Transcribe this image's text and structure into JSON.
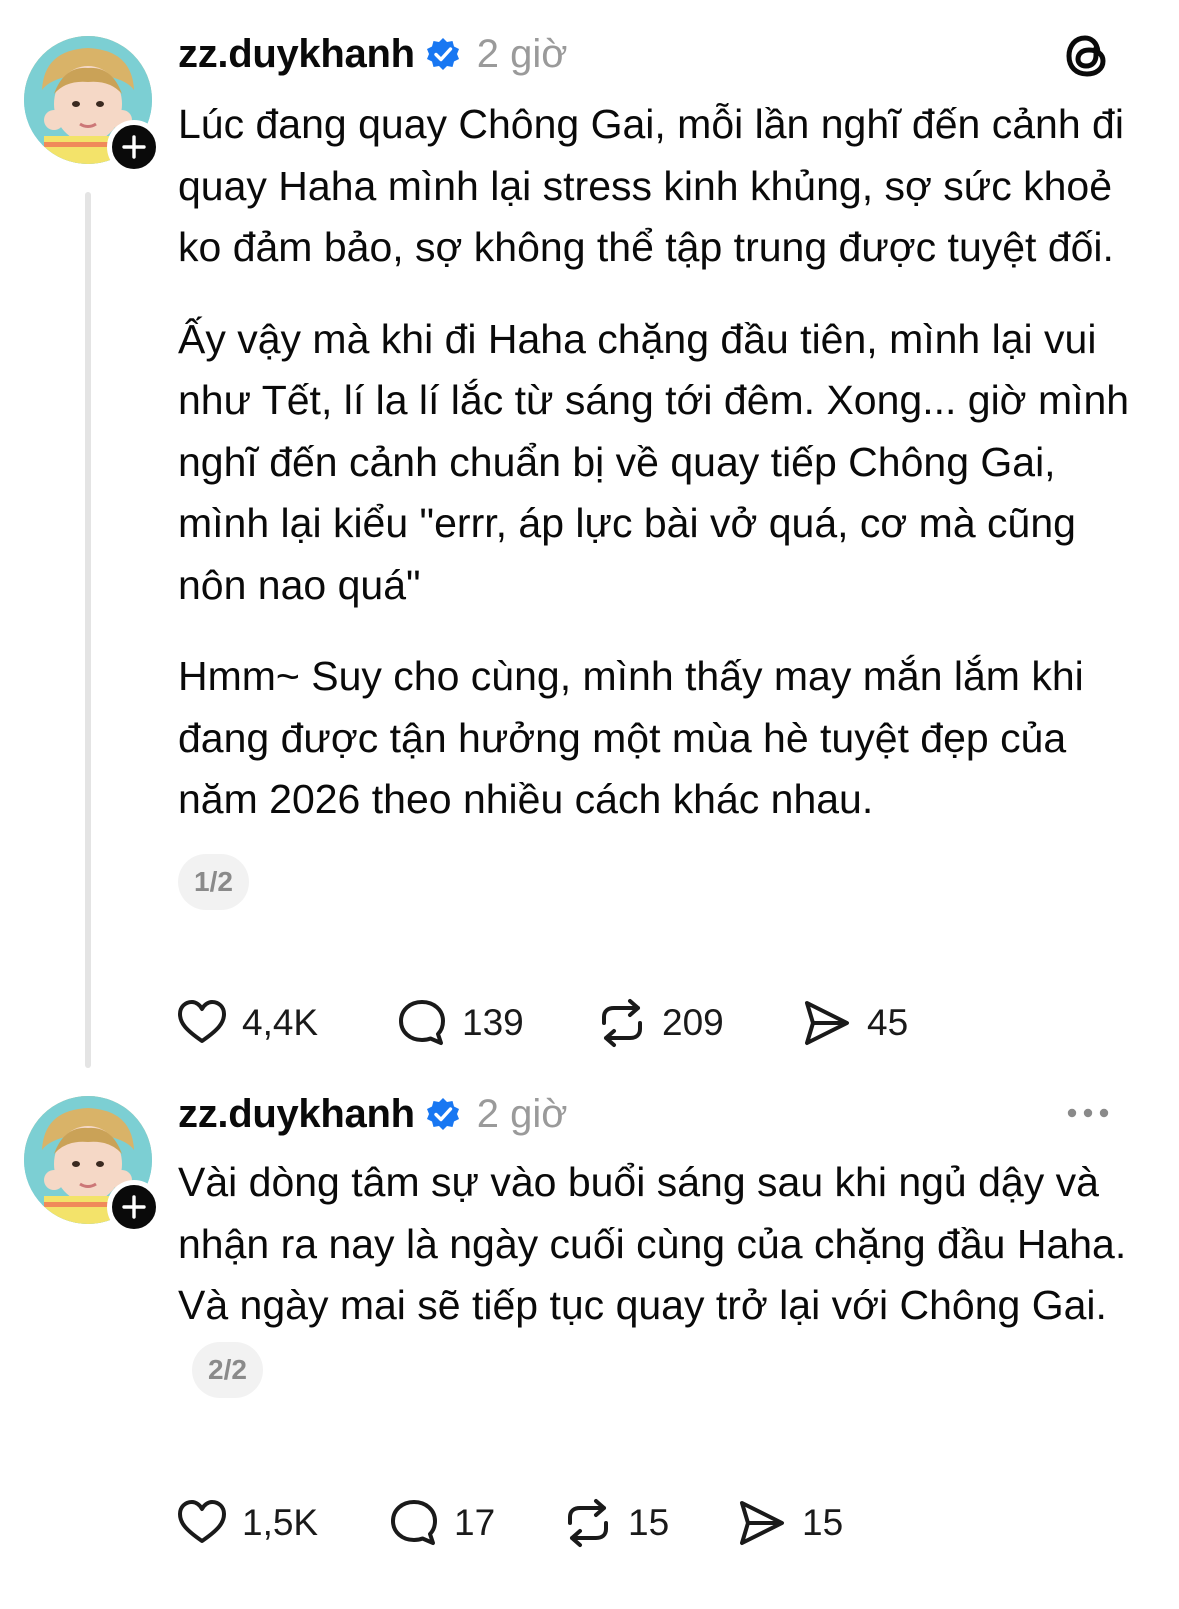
{
  "posts": [
    {
      "username": "zz.duykhanh",
      "time": "2 giờ",
      "paragraphs": [
        "Lúc đang quay Chông Gai, mỗi lần nghĩ đến cảnh đi quay Haha mình lại stress kinh khủng, sợ sức khoẻ ko đảm bảo, sợ không thể tập trung được tuyệt đối.",
        "Ấy vậy mà khi đi Haha chặng đầu tiên, mình lại vui như Tết, lí la lí lắc từ sáng tới đêm. Xong... giờ mình nghĩ đến cảnh chuẩn bị về quay tiếp Chông Gai, mình lại kiểu \"errr, áp lực bài vở quá, cơ mà cũng nôn nao quá\"",
        "Hmm~ Suy cho cùng, mình thấy may mắn lắm khi  đang được tận hưởng một mùa hè tuyệt đẹp của năm 2026 theo nhiều cách khác nhau."
      ],
      "pager": "1/2",
      "likes": "4,4K",
      "comments": "139",
      "reposts": "209",
      "shares": "45"
    },
    {
      "username": "zz.duykhanh",
      "time": "2 giờ",
      "paragraphs": [
        "Vài dòng tâm sự vào buổi sáng sau khi ngủ dậy và nhận ra nay là ngày cuối cùng của chặng đầu Haha.",
        "Và ngày mai sẽ tiếp tục quay trở lại với Chông Gai."
      ],
      "pager": "2/2",
      "likes": "1,5K",
      "comments": "17",
      "reposts": "15",
      "shares": "15"
    }
  ],
  "icons": {
    "app": "threads-logo-icon",
    "verified": "verified-badge-icon",
    "follow": "plus-icon",
    "like": "heart-icon",
    "comment": "comment-bubble-icon",
    "repost": "repost-icon",
    "share": "send-icon",
    "more": "more-dots-icon"
  },
  "colors": {
    "verified": "#1877f2",
    "muted": "#9a9a9a",
    "text": "#0a0a0a"
  }
}
